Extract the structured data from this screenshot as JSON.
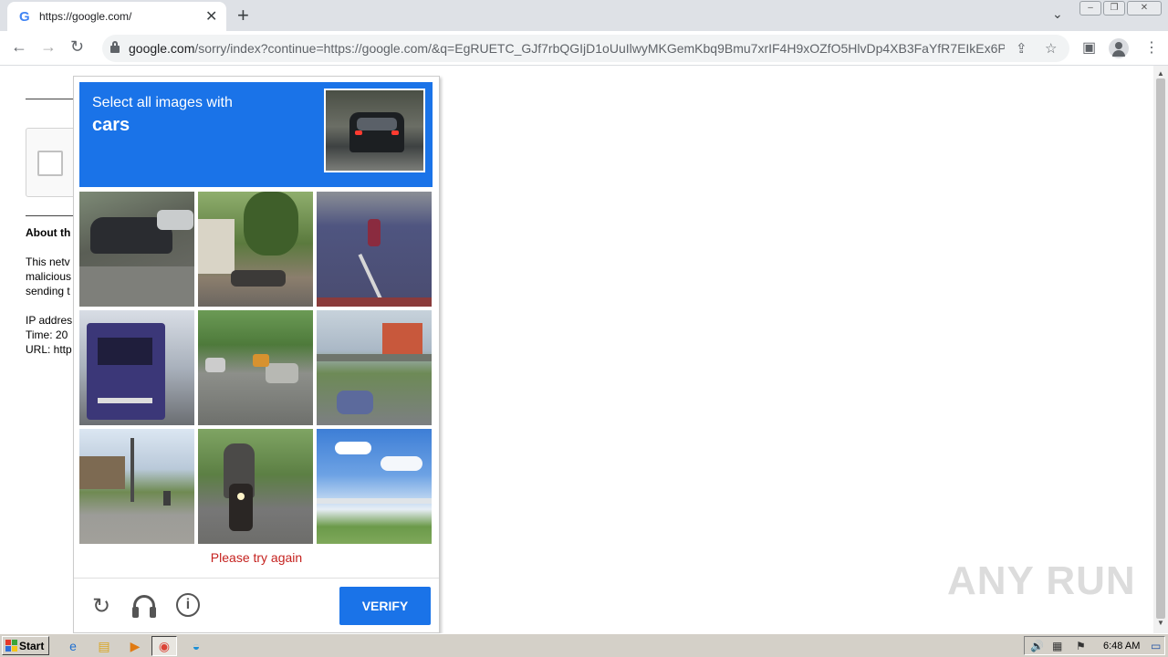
{
  "browser": {
    "tab_title": "https://google.com/",
    "tab_favicon": "G",
    "close_glyph": "✕",
    "new_tab_glyph": "+",
    "url_host": "google.com",
    "url_path": "/sorry/index?continue=https://google.com/&q=EgRUETC_GJf7rbQGIjD1oUuIlwyMKGemKbq9Bmu7xrIF4H9xOZfO5HlvDp4XB3FaYfR7EIkEx6P..."
  },
  "page": {
    "about_heading": "About th",
    "lines": [
      "This netv",
      "malicious",
      "sending t",
      "IP addres",
      "Time: 20",
      "URL: http"
    ]
  },
  "captcha": {
    "instruction": "Select all images with",
    "keyword": "cars",
    "tiles": [
      {
        "name": "tile-1",
        "desc": "car on street corner"
      },
      {
        "name": "tile-2",
        "desc": "tree and motorbikes"
      },
      {
        "name": "tile-3",
        "desc": "motorbike on road"
      },
      {
        "name": "tile-4",
        "desc": "purple truck"
      },
      {
        "name": "tile-5",
        "desc": "street with cars"
      },
      {
        "name": "tile-6",
        "desc": "overpass with cars"
      },
      {
        "name": "tile-7",
        "desc": "village road"
      },
      {
        "name": "tile-8",
        "desc": "motorcycle rider"
      },
      {
        "name": "tile-9",
        "desc": "highway bridge sky"
      }
    ],
    "error": "Please try again",
    "verify_label": "VERIFY",
    "icons": [
      "reload-icon",
      "audio-icon",
      "info-icon"
    ],
    "accent_color": "#1a73e8",
    "error_color": "#c5221f"
  },
  "watermark": "ANY RUN",
  "taskbar": {
    "start_label": "Start",
    "clock": "6:48 AM"
  }
}
